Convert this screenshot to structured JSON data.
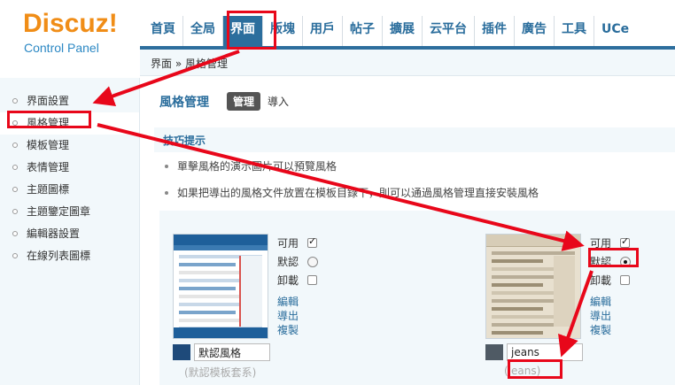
{
  "logo": {
    "brand": "Discuz!",
    "subtitle": "Control Panel"
  },
  "topnav": {
    "items": [
      {
        "label": "首頁"
      },
      {
        "label": "全局"
      },
      {
        "label": "界面"
      },
      {
        "label": "版塊"
      },
      {
        "label": "用戶"
      },
      {
        "label": "帖子"
      },
      {
        "label": "擴展"
      },
      {
        "label": "云平台"
      },
      {
        "label": "插件"
      },
      {
        "label": "廣告"
      },
      {
        "label": "工具"
      },
      {
        "label": "UCe"
      }
    ],
    "active_index": 2
  },
  "breadcrumb": {
    "text": "界面 » 風格管理"
  },
  "sidebar": {
    "items": [
      {
        "label": "界面設置"
      },
      {
        "label": "風格管理"
      },
      {
        "label": "模板管理"
      },
      {
        "label": "表情管理"
      },
      {
        "label": "主題圖標"
      },
      {
        "label": "主題鑒定圖章"
      },
      {
        "label": "編輯器設置"
      },
      {
        "label": "在線列表圖標"
      }
    ],
    "active_index": 1
  },
  "page": {
    "title": "風格管理",
    "tab_manage": "管理",
    "tab_import": "導入"
  },
  "tips": {
    "heading": "技巧提示",
    "items": [
      "單擊風格的演示圖片可以預覽風格",
      "如果把導出的風格文件放置在模板目錄下，則可以通過風格管理直接安裝風格"
    ]
  },
  "themes": [
    {
      "name": "默認風格",
      "dir": "(默認模板套系)",
      "swatch_color": "#1e4a7a",
      "options": {
        "available_label": "可用",
        "default_label": "默認",
        "uninstall_label": "卸載"
      },
      "available_checked": true,
      "is_default": false,
      "links": {
        "edit": "編輯",
        "export": "導出",
        "copy": "複製"
      }
    },
    {
      "name": "jeans",
      "dir": "(jeans)",
      "swatch_color": "#4f5a64",
      "options": {
        "available_label": "可用",
        "default_label": "默認",
        "uninstall_label": "卸載"
      },
      "available_checked": true,
      "is_default": true,
      "links": {
        "edit": "編輯",
        "export": "導出",
        "copy": "複製"
      }
    }
  ],
  "colors": {
    "brand_orange": "#f08d17",
    "nav_blue": "#2b6e9d",
    "annotation_red": "#e8071a",
    "panel_bg": "#f2f8fb"
  }
}
